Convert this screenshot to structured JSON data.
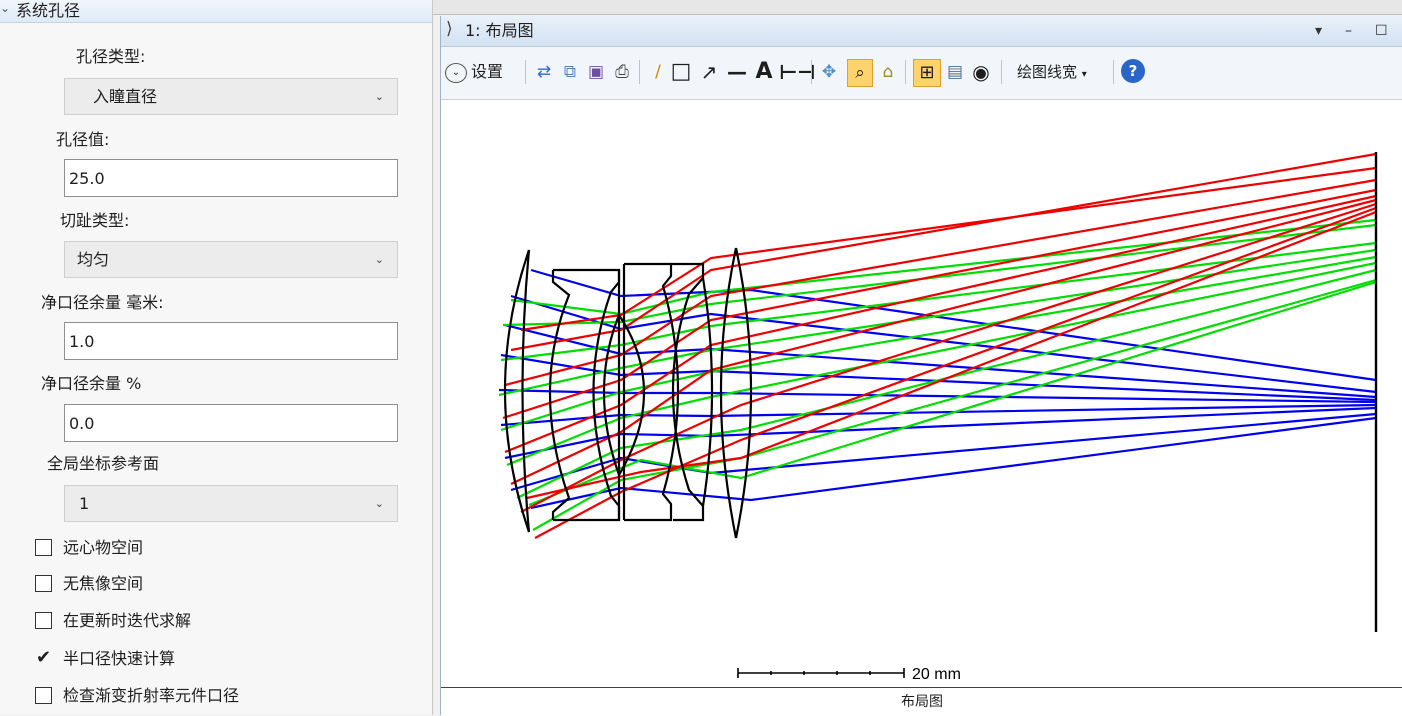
{
  "left_panel": {
    "section_title": "系统孔径",
    "aperture_type_label": "孔径类型:",
    "aperture_type_value": "入瞳直径",
    "aperture_value_label": "孔径值:",
    "aperture_value": "25.0",
    "apodization_label": "切趾类型:",
    "apodization_value": "均匀",
    "clear_margin_mm_label": "净口径余量 毫米:",
    "clear_margin_mm_value": "1.0",
    "clear_margin_pct_label": "净口径余量 %",
    "clear_margin_pct_value": "0.0",
    "global_ref_label": "全局坐标参考面",
    "global_ref_value": "1",
    "checkboxes": [
      {
        "label": "远心物空间",
        "checked": false
      },
      {
        "label": "无焦像空间",
        "checked": false
      },
      {
        "label": "在更新时迭代求解",
        "checked": false
      },
      {
        "label": "半口径快速计算",
        "checked": true
      },
      {
        "label": "检查渐变折射率元件口径",
        "checked": false
      }
    ]
  },
  "window": {
    "title": "1: 布局图",
    "settings_label": "设置",
    "line_width_label": "绘图线宽",
    "footer_label": "布局图",
    "scale_label": "20 mm"
  },
  "colors": {
    "ray_blue": "#0000ee",
    "ray_green": "#00dd00",
    "ray_red": "#ee0000",
    "lens_black": "#000000"
  },
  "icons": [
    "settings-chevron-icon",
    "refresh-icon",
    "copy-icon",
    "save-icon",
    "print-icon",
    "pencil-icon",
    "rectangle-icon",
    "arrow-icon",
    "line-icon",
    "text-icon",
    "dimension-icon",
    "pan-icon",
    "zoom-icon",
    "lock-icon",
    "fit-icon",
    "window-icon",
    "rotate-icon",
    "help-icon"
  ]
}
